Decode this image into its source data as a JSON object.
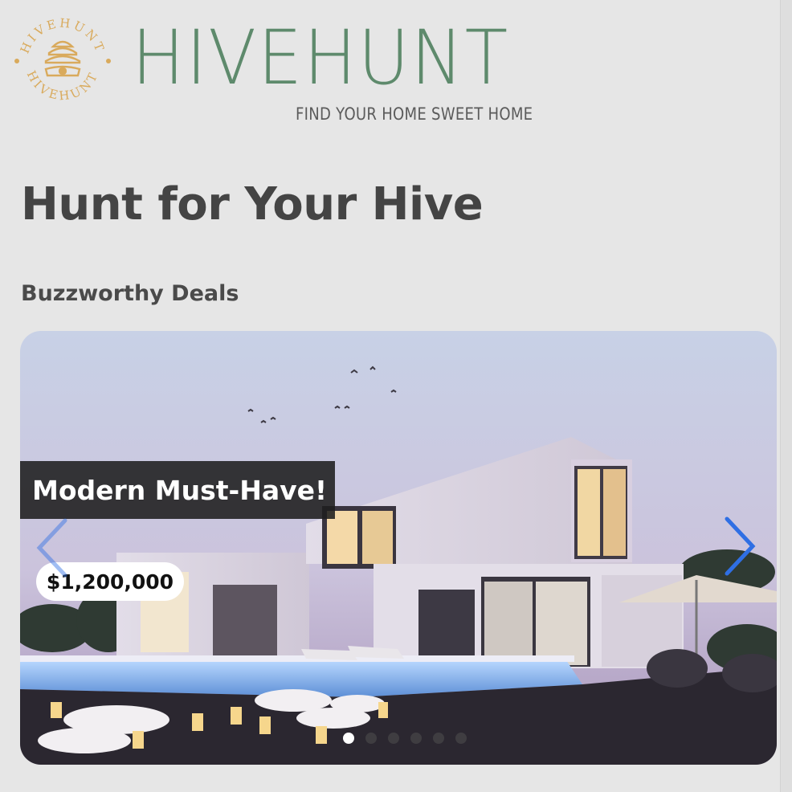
{
  "brand": {
    "name": "HIVEHUNT",
    "tagline": "FIND YOUR HOME SWEET HOME",
    "badge_text_top": "HIVEHUNT",
    "badge_text_bottom": "HIVEHUNT"
  },
  "page": {
    "title": "Hunt for Your Hive",
    "section_title": "Buzzworthy Deals"
  },
  "carousel": {
    "slide_caption": "Modern Must-Have!",
    "price": "$1,200,000",
    "slide_count": 6,
    "active_slide": 1
  },
  "colors": {
    "brand_green": "#5e8a6c",
    "badge_gold": "#d9aa5c",
    "arrow_blue": "#2f6fe4",
    "background": "#e6e6e6"
  },
  "icons": [
    "beehive-icon",
    "chevron-left-icon",
    "chevron-right-icon"
  ]
}
